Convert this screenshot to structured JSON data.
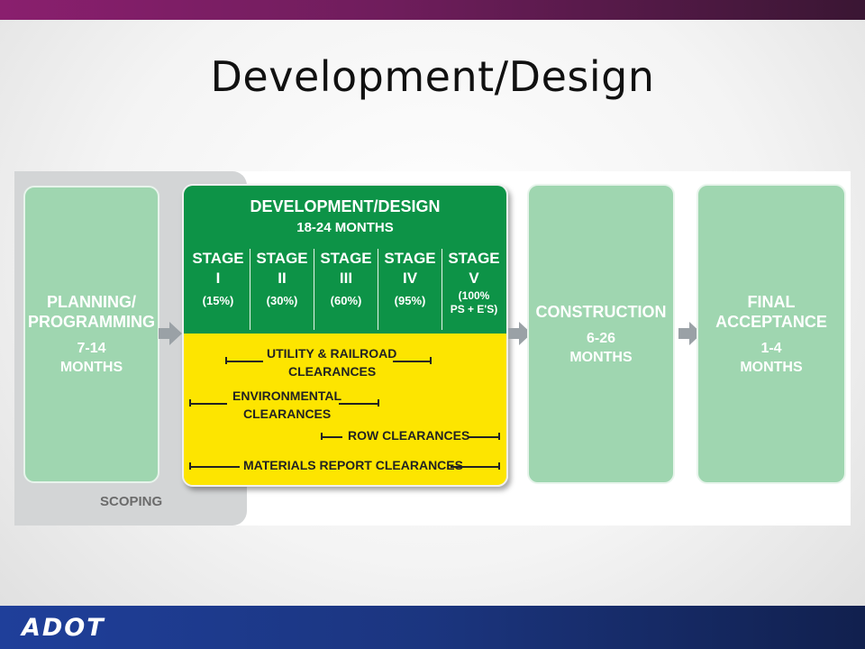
{
  "slide": {
    "title": "Development/Design"
  },
  "diagram": {
    "scoping": {
      "label": "SCOPING"
    },
    "planning": {
      "name_l1": "PLANNING/",
      "name_l2": "PROGRAMMING",
      "dur_l1": "7-14",
      "dur_l2": "MONTHS"
    },
    "development": {
      "title": "DEVELOPMENT/DESIGN",
      "duration": "18-24 MONTHS",
      "stages": [
        {
          "head": "STAGE",
          "num": "I",
          "pct": "(15%)"
        },
        {
          "head": "STAGE",
          "num": "II",
          "pct": "(30%)"
        },
        {
          "head": "STAGE",
          "num": "III",
          "pct": "(60%)"
        },
        {
          "head": "STAGE",
          "num": "IV",
          "pct": "(95%)"
        },
        {
          "head": "STAGE",
          "num": "V",
          "pct_l1": "(100%",
          "pct_l2": "PS + E'S)"
        }
      ],
      "clearances": {
        "utility_l1": "UTILITY & RAILROAD",
        "utility_l2": "CLEARANCES",
        "env_l1": "ENVIRONMENTAL",
        "env_l2": "CLEARANCES",
        "row": "ROW CLEARANCES",
        "materials": "MATERIALS REPORT CLEARANCES"
      }
    },
    "construction": {
      "name": "CONSTRUCTION",
      "dur_l1": "6-26",
      "dur_l2": "MONTHS"
    },
    "final": {
      "name_l1": "FINAL",
      "name_l2": "ACCEPTANCE",
      "dur_l1": "1-4",
      "dur_l2": "MONTHS"
    }
  },
  "footer": {
    "logo": "ADOT"
  },
  "colors": {
    "top_bar": "#7a1f66",
    "phase_box": "#9fd6b0",
    "dev_green": "#0d9347",
    "dev_yellow": "#fde500",
    "scoping_panel": "#d3d5d6",
    "arrow": "#9aa1a6",
    "bottom_bar": "#1b357f"
  },
  "icons": {
    "flow_arrow": "right-arrow-icon"
  }
}
